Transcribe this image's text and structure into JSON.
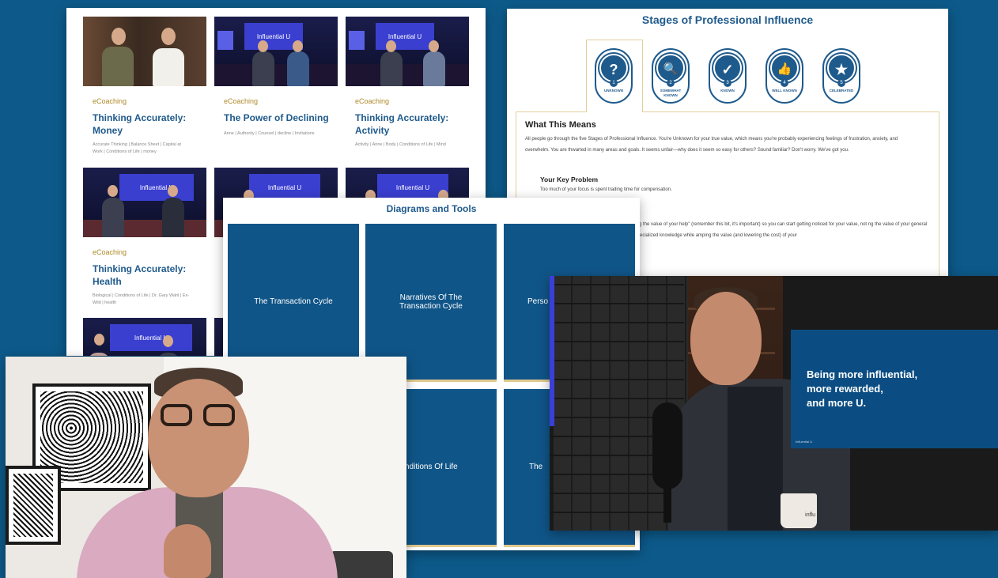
{
  "courses_panel": {
    "cards": [
      {
        "category": "eCoaching",
        "title": "Thinking Accurately: Money",
        "tags": "Accurate Thinking | Balance Sheet | Capital at Work | Conditions of Life | money"
      },
      {
        "category": "eCoaching",
        "title": "The Power of Declining",
        "tags": "Anne | Authority | Counsel | decline | Invitations"
      },
      {
        "category": "eCoaching",
        "title": "Thinking Accurately: Activity",
        "tags": "Activity | Anne | Body | Conditions of Life | Mind"
      },
      {
        "category": "eCoaching",
        "title": "Thinking Accurately: Health",
        "tags": "Biological | Conditions of Life | Dr. Gary Wahl | Ex-Wild | health"
      }
    ],
    "thumbnail_logo": "Influential U"
  },
  "stages_panel": {
    "title": "Stages of Professional Influence",
    "badges": [
      {
        "icon": "question-icon",
        "glyph": "?",
        "num": "1",
        "label": "UNKNOWN"
      },
      {
        "icon": "search-icon",
        "glyph": "🔍",
        "num": "2",
        "label": "SOMEWHAT KNOWN"
      },
      {
        "icon": "check-icon",
        "glyph": "✓",
        "num": "3",
        "label": "KNOWN"
      },
      {
        "icon": "thumbs-up-icon",
        "glyph": "👍",
        "num": "4",
        "label": "WELL KNOWN"
      },
      {
        "icon": "star-icon",
        "glyph": "★",
        "num": "5",
        "label": "CELEBRATED"
      }
    ],
    "heading": "What This Means",
    "body": "All people go through the five Stages of Professional Influence. You're Unknown for your true value, which means you're probably experiencing feelings of frustration, anxiety, and overwhelm. You are thwarted in many areas and goals. It seems unfair—why does it seem so easy for others? Sound familiar? Don't worry. We've got you.",
    "subheading": "Your Key Problem",
    "sub_body": "Too much of your focus is spent trading time for compensation.",
    "partial_text": "plishing the value of your help\" (remember this bit, it's important) so you can start getting noticed for your value, not ng the value of your general and specialized knowledge while amping the value (and lowering the cost) of your"
  },
  "diagrams_panel": {
    "title": "Diagrams and Tools",
    "tiles": [
      "The Transaction Cycle",
      "Narratives Of The Transaction Cycle",
      "Perso Tran",
      "nditions Of Life",
      "The"
    ]
  },
  "podcast_video": {
    "overlay_lines": [
      "Being more influential,",
      "more rewarded,",
      "and more U."
    ],
    "watermark": "Influential U",
    "mug_text": "influ"
  },
  "colors": {
    "background": "#0d5a8a",
    "brand_blue": "#1f5a8c",
    "tile_blue": "#105588",
    "gold": "#b08a2a"
  }
}
